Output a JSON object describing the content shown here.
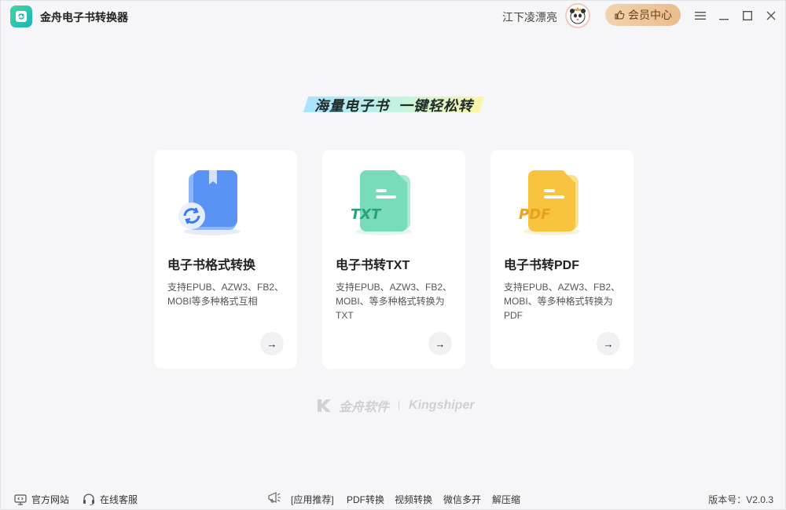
{
  "app": {
    "title": "金舟电子书转换器"
  },
  "header": {
    "username": "江下凌漂亮",
    "vip_label": "会员中心",
    "icons": {
      "menu": "menu-icon",
      "minimize": "minimize-icon",
      "maximize": "maximize-icon",
      "close": "close-icon"
    }
  },
  "slogan": "海量电子书  一键轻松转",
  "cards": [
    {
      "title": "电子书格式转换",
      "desc_lines": [
        "支持EPUB、AZW3、FB2、",
        "MOBI等多种格式互相"
      ],
      "icon": "ebook-convert-icon",
      "arrow": "→"
    },
    {
      "title": "电子书转TXT",
      "desc_lines": [
        "支持EPUB、AZW3、FB2、",
        "MOBI、等多种格式转换为",
        "TXT"
      ],
      "icon": "ebook-txt-icon",
      "badge": "TXT",
      "arrow": "→"
    },
    {
      "title": "电子书转PDF",
      "desc_lines": [
        "支持EPUB、AZW3、FB2、",
        "MOBI、等多种格式转换为",
        "PDF"
      ],
      "icon": "ebook-pdf-icon",
      "badge": "PDF",
      "arrow": "→"
    }
  ],
  "brand": {
    "cn": "金舟软件",
    "en": "Kingshiper"
  },
  "footer": {
    "official_site": "官方网站",
    "online_service": "在线客服",
    "recommend": "[应用推荐]",
    "links": [
      "PDF转换",
      "视频转换",
      "微信多开",
      "解压缩"
    ],
    "version": "版本号：V2.0.3"
  },
  "colors": {
    "accent_green": "#2fc7a8",
    "vip_gold": "#e9bd8c",
    "card_blue": "#5b93f5",
    "card_green": "#6fdcb8",
    "card_yellow": "#f8c440"
  }
}
